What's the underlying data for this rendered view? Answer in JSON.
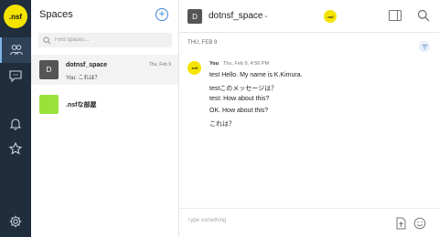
{
  "rail": {
    "logo_text": ".nsf",
    "items": [
      {
        "icon": "people-icon",
        "active": true
      },
      {
        "icon": "chat-bubble-icon",
        "active": false
      },
      {
        "icon": "bell-icon",
        "active": false
      },
      {
        "icon": "star-icon",
        "active": false
      },
      {
        "icon": "gear-icon",
        "active": false
      }
    ],
    "colors": {
      "background": "#1f2d3d",
      "accent": "#f5e400"
    }
  },
  "spaces": {
    "title": "Spaces",
    "add_label": "+",
    "search_placeholder": "Find spaces...",
    "items": [
      {
        "avatar_letter": "D",
        "avatar_color": "#555555",
        "name": "dotnsf_space",
        "preview": "You: これは？",
        "date": "Thu, Feb 9"
      },
      {
        "avatar_letter": "",
        "avatar_color": "#99e23a",
        "name": ".nsfな部屋",
        "preview": "",
        "date": ""
      }
    ]
  },
  "chat": {
    "header": {
      "avatar_letter": "D",
      "title": "dotnsf_space",
      "chevron": "⌄",
      "logo_text": ".nsf"
    },
    "date_separator": "THU, FEB 9",
    "message": {
      "avatar_text": ".nsf",
      "sender": "You",
      "timestamp": "Thu, Feb 9, 4:56 PM",
      "lines": [
        "test Hello. My name is K.Kimura.",
        "testこのメッセージは？",
        "test: How about this?",
        "OK. How about this?",
        "これは？"
      ]
    },
    "composer": {
      "placeholder": "Type something"
    }
  }
}
